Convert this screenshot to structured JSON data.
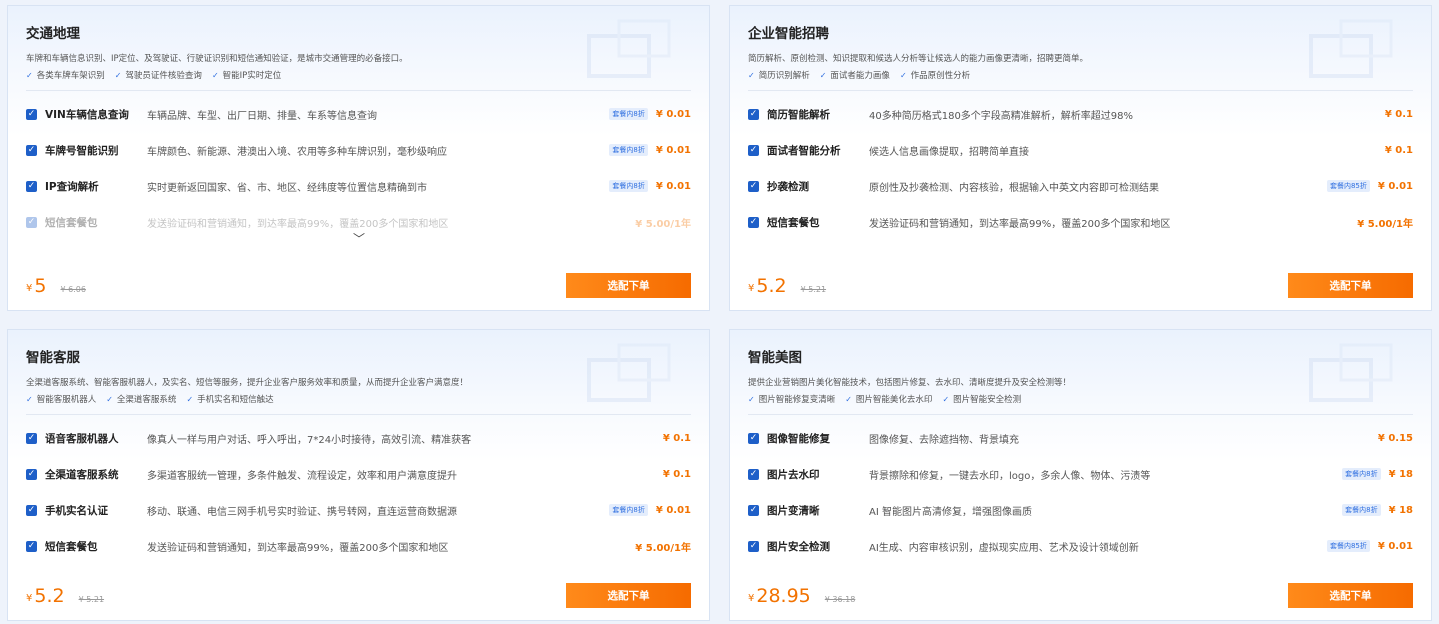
{
  "cards": [
    {
      "title": "交通地理",
      "desc": "车牌和车辆信息识别、IP定位、及驾驶证、行驶证识别和短信通知验证，是城市交通管理的必备接口。",
      "features": [
        "各类车牌车架识别",
        "驾驶员证件核验查询",
        "智能IP实时定位"
      ],
      "items": [
        {
          "name": "VIN车辆信息查询",
          "desc": "车辆品牌、车型、出厂日期、排量、车系等信息查询",
          "badge": "套餐内8折",
          "price": "¥ 0.01"
        },
        {
          "name": "车牌号智能识别",
          "desc": "车牌颜色、新能源、港澳出入境、农用等多种车牌识别，毫秒级响应",
          "badge": "套餐内8折",
          "price": "¥ 0.01"
        },
        {
          "name": "IP查询解析",
          "desc": "实时更新返回国家、省、市、地区、经纬度等位置信息精确到市",
          "badge": "套餐内8折",
          "price": "¥ 0.01"
        },
        {
          "name": "短信套餐包",
          "desc": "发送验证码和营销通知，到达率最高99%，覆盖200多个国家和地区",
          "badge": "",
          "price": "¥ 5.00/1年"
        }
      ],
      "currency": "¥",
      "price": "5",
      "original_price": "¥ 6.06",
      "button": "选配下单"
    },
    {
      "title": "企业智能招聘",
      "desc": "简历解析、原创检测、知识提取和候选人分析等让候选人的能力画像更清晰，招聘更简单。",
      "features": [
        "简历识别解析",
        "面试者能力画像",
        "作品原创性分析"
      ],
      "items": [
        {
          "name": "简历智能解析",
          "desc": "40多种简历格式180多个字段高精准解析，解析率超过98%",
          "badge": "",
          "price": "¥ 0.1"
        },
        {
          "name": "面试者智能分析",
          "desc": "候选人信息画像提取，招聘简单直接",
          "badge": "",
          "price": "¥ 0.1"
        },
        {
          "name": "抄袭检测",
          "desc": "原创性及抄袭检测、内容核验，根据输入中英文内容即可检测结果",
          "badge": "套餐内85折",
          "price": "¥ 0.01"
        },
        {
          "name": "短信套餐包",
          "desc": "发送验证码和营销通知，到达率最高99%，覆盖200多个国家和地区",
          "badge": "",
          "price": "¥ 5.00/1年"
        }
      ],
      "currency": "¥",
      "price": "5.2",
      "original_price": "¥ 5.21",
      "button": "选配下单"
    },
    {
      "title": "智能客服",
      "desc": "全渠道客服系统、智能客服机器人，及实名、短信等服务，提升企业客户服务效率和质量，从而提升企业客户满意度！",
      "features": [
        "智能客服机器人",
        "全渠道客服系统",
        "手机实名和短信触达"
      ],
      "items": [
        {
          "name": "语音客服机器人",
          "desc": "像真人一样与用户对话、呼入呼出，7*24小时接待，高效引流、精准获客",
          "badge": "",
          "price": "¥ 0.1"
        },
        {
          "name": "全渠道客服系统",
          "desc": "多渠道客服统一管理，多条件触发、流程设定，效率和用户满意度提升",
          "badge": "",
          "price": "¥ 0.1"
        },
        {
          "name": "手机实名认证",
          "desc": "移动、联通、电信三网手机号实时验证、携号转网，直连运营商数据源",
          "badge": "套餐内8折",
          "price": "¥ 0.01"
        },
        {
          "name": "短信套餐包",
          "desc": "发送验证码和营销通知，到达率最高99%，覆盖200多个国家和地区",
          "badge": "",
          "price": "¥ 5.00/1年"
        }
      ],
      "currency": "¥",
      "price": "5.2",
      "original_price": "¥ 5.21",
      "button": "选配下单"
    },
    {
      "title": "智能美图",
      "desc": "提供企业营销图片美化智能技术，包括图片修复、去水印、清晰度提升及安全检测等！",
      "features": [
        "图片智能修复变清晰",
        "图片智能美化去水印",
        "图片智能安全检测"
      ],
      "items": [
        {
          "name": "图像智能修复",
          "desc": "图像修复、去除遮挡物、背景填充",
          "badge": "",
          "price": "¥ 0.15"
        },
        {
          "name": "图片去水印",
          "desc": "背景擦除和修复，一键去水印，logo，多余人像、物体、污渍等",
          "badge": "套餐内8折",
          "price": "¥ 18"
        },
        {
          "name": "图片变清晰",
          "desc": "AI 智能图片高清修复，增强图像画质",
          "badge": "套餐内8折",
          "price": "¥ 18"
        },
        {
          "name": "图片安全检测",
          "desc": "AI生成、内容审核识别，虚拟现实应用、艺术及设计领域创新",
          "badge": "套餐内85折",
          "price": "¥ 0.01"
        }
      ],
      "currency": "¥",
      "price": "28.95",
      "original_price": "¥ 36.18",
      "button": "选配下单"
    }
  ],
  "icons": {
    "checkbox": "check-icon",
    "feature": "check-mark-icon",
    "expand": "chevron-down-icon"
  },
  "colors": {
    "accent": "#1e5fc8",
    "price": "#f27200",
    "button": "#f66b00"
  }
}
